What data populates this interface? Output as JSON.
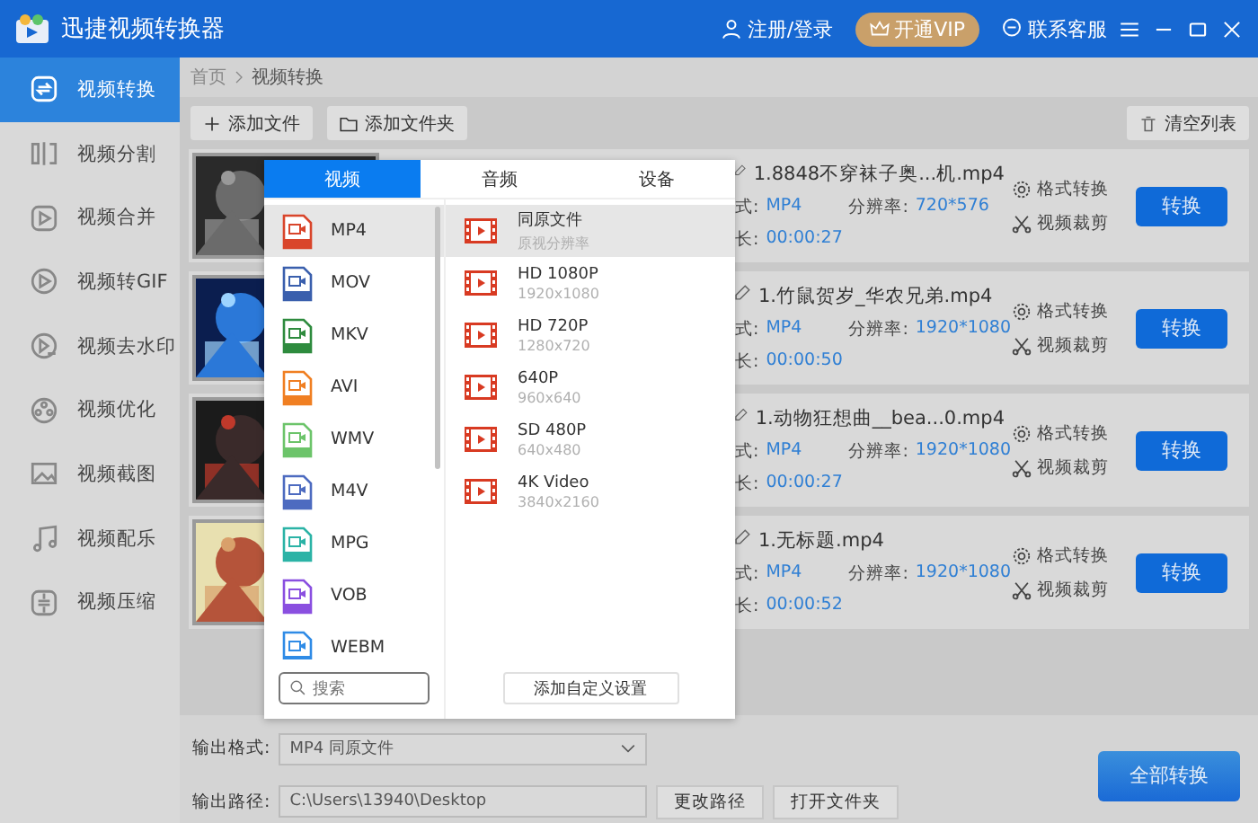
{
  "window": {
    "title": "迅捷视频转换器",
    "login": "注册/登录",
    "vip": "开通VIP",
    "support": "联系客服"
  },
  "sidebar": {
    "items": [
      {
        "label": "视频转换",
        "selected": true
      },
      {
        "label": "视频分割",
        "selected": false
      },
      {
        "label": "视频合并",
        "selected": false
      },
      {
        "label": "视频转GIF",
        "selected": false
      },
      {
        "label": "视频去水印",
        "selected": false
      },
      {
        "label": "视频优化",
        "selected": false
      },
      {
        "label": "视频截图",
        "selected": false
      },
      {
        "label": "视频配乐",
        "selected": false
      },
      {
        "label": "视频压缩",
        "selected": false
      }
    ]
  },
  "breadcrumb": [
    "首页",
    "视频转换"
  ],
  "toolbar": {
    "add_file": "添加文件",
    "add_folder": "添加文件夹",
    "clear": "清空列表"
  },
  "files": [
    {
      "name": "1.8848不穿袜子奥...机.mp4",
      "format_label": "式:",
      "format": "MP4",
      "res_label": "分辨率:",
      "resolution": "720*576",
      "dur_label": "长:",
      "duration": "00:00:27",
      "action_1": "格式转换",
      "action_2": "视频裁剪",
      "button": "转换",
      "kind": "picture"
    },
    {
      "name": "1.竹鼠贺岁_华农兄弟.mp4",
      "format_label": "式:",
      "format": "MP4",
      "res_label": "分辨率:",
      "resolution": "1920*1080",
      "dur_label": "长:",
      "duration": "00:00:50",
      "action_1": "格式转换",
      "action_2": "视频裁剪",
      "button": "转换",
      "kind": "picture"
    },
    {
      "name": "1.动物狂想曲__bea...0.mp4",
      "format_label": "式:",
      "format": "MP4",
      "res_label": "分辨率:",
      "resolution": "1920*1080",
      "dur_label": "长:",
      "duration": "00:00:27",
      "action_1": "格式转换",
      "action_2": "视频裁剪",
      "button": "转换",
      "kind": "picture"
    },
    {
      "name": "1.无标题.mp4",
      "format_label": "式:",
      "format": "MP4",
      "res_label": "分辨率:",
      "resolution": "1920*1080",
      "dur_label": "长:",
      "duration": "00:00:52",
      "action_1": "格式转换",
      "action_2": "视频裁剪",
      "button": "转换",
      "kind": "picture"
    }
  ],
  "format_popup": {
    "tabs": [
      {
        "label": "视频",
        "selected": true
      },
      {
        "label": "音频",
        "selected": false
      },
      {
        "label": "设备",
        "selected": false
      }
    ],
    "formats": [
      {
        "label": "MP4",
        "color": "#d9452b",
        "selected": true
      },
      {
        "label": "MOV",
        "color": "#3a5fad",
        "selected": false
      },
      {
        "label": "MKV",
        "color": "#2e8b3e",
        "selected": false
      },
      {
        "label": "AVI",
        "color": "#f07f22",
        "selected": false
      },
      {
        "label": "WMV",
        "color": "#6cc46a",
        "selected": false
      },
      {
        "label": "M4V",
        "color": "#4d6bc0",
        "selected": false
      },
      {
        "label": "MPG",
        "color": "#2bb3a6",
        "selected": false
      },
      {
        "label": "VOB",
        "color": "#8a4fe0",
        "selected": false
      },
      {
        "label": "WEBM",
        "color": "#2f8be6",
        "selected": false
      }
    ],
    "presets": [
      {
        "name": "同原文件",
        "detail": "原视分辨率",
        "selected": true
      },
      {
        "name": "HD 1080P",
        "detail": "1920x1080",
        "selected": false
      },
      {
        "name": "HD 720P",
        "detail": "1280x720",
        "selected": false
      },
      {
        "name": "640P",
        "detail": "960x640",
        "selected": false
      },
      {
        "name": "SD 480P",
        "detail": "640x480",
        "selected": false
      },
      {
        "name": "4K Video",
        "detail": "3840x2160",
        "selected": false
      }
    ],
    "search": {
      "placeholder": "搜索"
    },
    "custom_button": "添加自定义设置"
  },
  "output": {
    "format_label": "输出格式:",
    "format_value": "MP4  同原文件",
    "path_label": "输出路径:",
    "path_value": "C:\\Users\\13940\\Desktop",
    "change_path": "更改路径",
    "open_folder": "打开文件夹",
    "convert_all": "全部转换"
  }
}
